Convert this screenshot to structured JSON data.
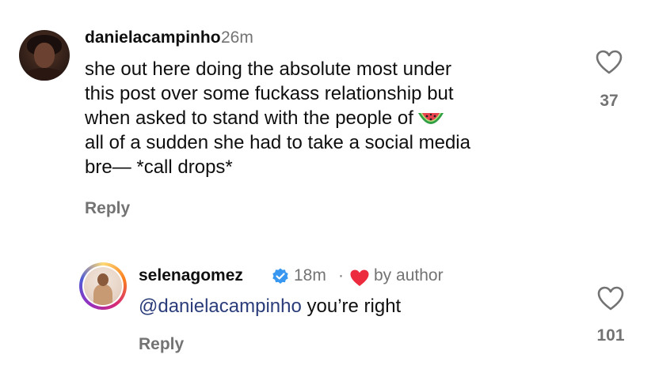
{
  "comment1": {
    "username": "danielacampinho",
    "time": "26m",
    "lines": [
      "she out here doing the absolute most under",
      "this post over some fuckass relationship but",
      "when asked to stand with the people of",
      "all of a sudden she had to take a social media",
      "bre— *call drops*"
    ],
    "emoji": "watermelon-icon",
    "reply_label": "Reply",
    "like_count": "37"
  },
  "comment2": {
    "username": "selenagomez",
    "time": "18m",
    "separator": "·",
    "author_badge": "by author",
    "mention": "@danielacampinho",
    "text_rest": " you’re right",
    "reply_label": "Reply",
    "like_count": "101"
  },
  "colors": {
    "text": "#0f0f0f",
    "muted": "#737373",
    "verified": "#3897f0",
    "heart_red": "#ed2b3e",
    "mention": "#2a3c7a"
  }
}
